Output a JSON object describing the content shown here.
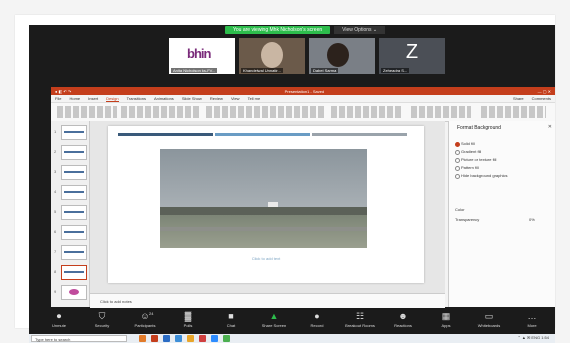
{
  "zoom": {
    "share_label": "You are viewing Mhk Nicholson's screen",
    "view_options": "View Options ⌄",
    "participants": [
      {
        "name": "Anita Nicholson ks-FV...",
        "type": "logo",
        "logo_text": "bhin"
      },
      {
        "name": "Khandelwal Unnatir...",
        "type": "person"
      },
      {
        "name": "Dabei Sarma",
        "type": "person"
      },
      {
        "name": "Zeheadra S...",
        "type": "letter",
        "letter": "Z"
      }
    ],
    "controls": [
      {
        "label": "Unmute",
        "icon": "mic-muted-icon",
        "glyph": "⏺"
      },
      {
        "label": "Security",
        "icon": "shield-icon",
        "glyph": "⛉"
      },
      {
        "label": "Participants",
        "icon": "participants-icon",
        "glyph": "☺",
        "badge": "24"
      },
      {
        "label": "Polls",
        "icon": "polls-icon",
        "glyph": "▓"
      },
      {
        "label": "Chat",
        "icon": "chat-icon",
        "glyph": "■"
      },
      {
        "label": "Share Screen",
        "icon": "share-screen-icon",
        "glyph": "▲"
      },
      {
        "label": "Record",
        "icon": "record-icon",
        "glyph": "●"
      },
      {
        "label": "Breakout Rooms",
        "icon": "breakout-rooms-icon",
        "glyph": "☷"
      },
      {
        "label": "Reactions",
        "icon": "reactions-icon",
        "glyph": "☻"
      },
      {
        "label": "Apps",
        "icon": "apps-icon",
        "glyph": "▦"
      },
      {
        "label": "Whiteboards",
        "icon": "whiteboard-icon",
        "glyph": "▭"
      },
      {
        "label": "More",
        "icon": "more-icon",
        "glyph": "…"
      }
    ]
  },
  "ppt": {
    "doc_title": "Presentation1 - Saved",
    "menu": [
      "File",
      "Home",
      "Insert",
      "Design",
      "Transitions",
      "Animations",
      "Slide Show",
      "Review",
      "View",
      "Tell me"
    ],
    "active_menu": "Design",
    "right_menu": [
      "Share",
      "Comments"
    ],
    "notes": "Click to add notes",
    "slide_caption": "Click to add text",
    "slide_numbers": [
      "1",
      "2",
      "3",
      "4",
      "5",
      "6",
      "7",
      "8",
      "9"
    ],
    "pane": {
      "title": "Format Background",
      "options": [
        "Solid fill",
        "Gradient fill",
        "Picture or texture fill",
        "Pattern fill",
        "Hide background graphics"
      ],
      "selected": 0,
      "color_label": "Color",
      "transparency_label": "Transparency",
      "transparency_value": "0%"
    },
    "stripe_colors": [
      "#3a5a7a",
      "#6a9cc4",
      "#9aa3ab"
    ]
  },
  "taskbar": {
    "search_placeholder": "Type here to search",
    "tray": "⌃ ▲ ✉ ENG 1:54"
  }
}
